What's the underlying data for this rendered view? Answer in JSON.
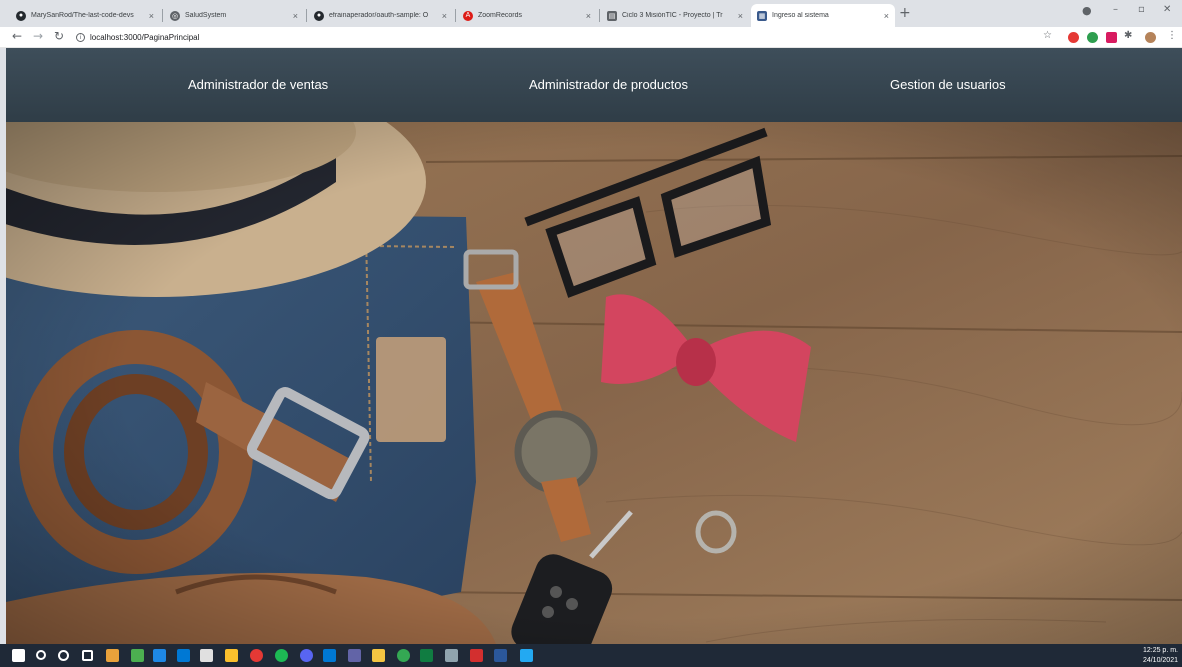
{
  "browser": {
    "tabs": [
      {
        "label": "MarySanRod/The-last-code-devs",
        "icon": "github-icon",
        "color": "#24292e"
      },
      {
        "label": "SaludSystem",
        "icon": "globe-icon",
        "color": "#5f6368"
      },
      {
        "label": "efrainaperador/oauth-sample: O",
        "icon": "github-icon",
        "color": "#24292e"
      },
      {
        "label": "ZoomRecords",
        "icon": "angular-icon",
        "color": "#dd1b16"
      },
      {
        "label": "Ciclo 3 MisiónTIC - Proyecto | Tr",
        "icon": "document-icon",
        "color": "#5f6368"
      },
      {
        "label": "Ingreso al sistema",
        "icon": "app-icon",
        "color": "#3a5a8c"
      }
    ],
    "active_tab": 5,
    "url": "localhost:3000/PaginaPrincipal"
  },
  "nav": {
    "ventas": "Administrador de ventas",
    "productos": "Administrador de productos",
    "usuarios": "Gestion de usuarios"
  },
  "taskbar": {
    "time": "12:25 p. m.",
    "date": "24/10/2021"
  },
  "colors": {
    "nav_bg": "#34434e",
    "wood": "#8a6a4c",
    "bowtie": "#d3455f"
  }
}
